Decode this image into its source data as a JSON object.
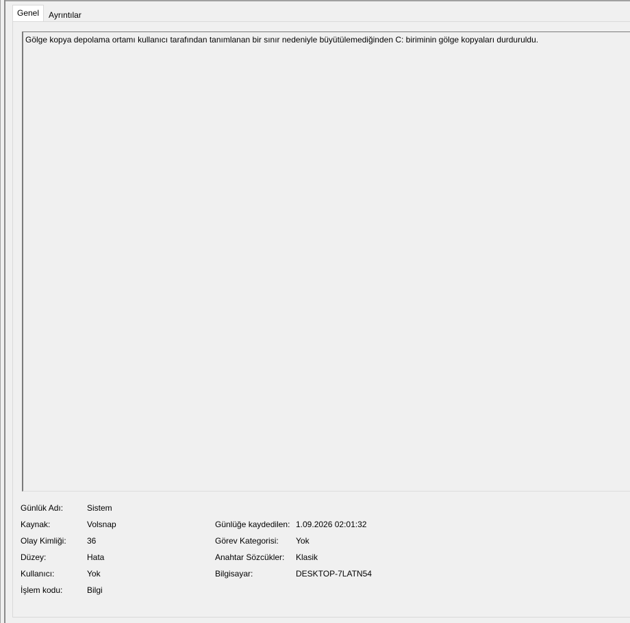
{
  "tabs": [
    {
      "label": "Genel",
      "active": true
    },
    {
      "label": "Ayrıntılar",
      "active": false
    }
  ],
  "description": "Gölge kopya depolama ortamı kullanıcı tarafından tanımlanan bir sınır nedeniyle büyütülemediğinden C: biriminin gölge kopyaları durduruldu.",
  "properties": {
    "log_name": {
      "label": "Günlük Adı:",
      "value": "Sistem"
    },
    "source": {
      "label": "Kaynak:",
      "value": "Volsnap"
    },
    "event_id": {
      "label": "Olay Kimliği:",
      "value": "36"
    },
    "level": {
      "label": "Düzey:",
      "value": "Hata"
    },
    "user": {
      "label": "Kullanıcı:",
      "value": "Yok"
    },
    "opcode": {
      "label": "İşlem kodu:",
      "value": "Bilgi"
    },
    "logged": {
      "label": "Günlüğe kaydedilen:",
      "value": "1.09.2026 02:01:32"
    },
    "task_category": {
      "label": "Görev Kategorisi:",
      "value": "Yok"
    },
    "keywords": {
      "label": "Anahtar Sözcükler:",
      "value": "Klasik"
    },
    "computer": {
      "label": "Bilgisayar:",
      "value": "DESKTOP-7LATN54"
    }
  }
}
